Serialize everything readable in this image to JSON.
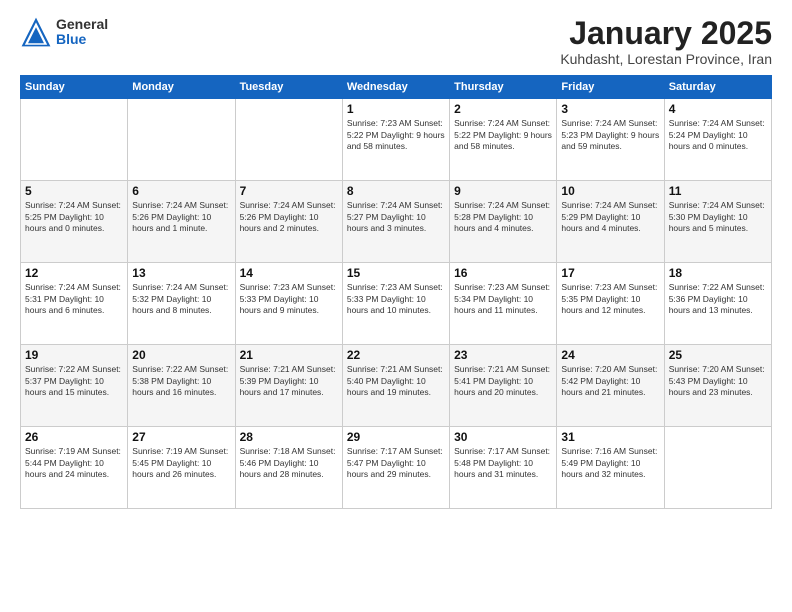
{
  "header": {
    "logo": {
      "general": "General",
      "blue": "Blue"
    },
    "title": "January 2025",
    "subtitle": "Kuhdasht, Lorestan Province, Iran"
  },
  "weekdays": [
    "Sunday",
    "Monday",
    "Tuesday",
    "Wednesday",
    "Thursday",
    "Friday",
    "Saturday"
  ],
  "weeks": [
    [
      {
        "day": "",
        "info": ""
      },
      {
        "day": "",
        "info": ""
      },
      {
        "day": "",
        "info": ""
      },
      {
        "day": "1",
        "info": "Sunrise: 7:23 AM\nSunset: 5:22 PM\nDaylight: 9 hours\nand 58 minutes."
      },
      {
        "day": "2",
        "info": "Sunrise: 7:24 AM\nSunset: 5:22 PM\nDaylight: 9 hours\nand 58 minutes."
      },
      {
        "day": "3",
        "info": "Sunrise: 7:24 AM\nSunset: 5:23 PM\nDaylight: 9 hours\nand 59 minutes."
      },
      {
        "day": "4",
        "info": "Sunrise: 7:24 AM\nSunset: 5:24 PM\nDaylight: 10 hours\nand 0 minutes."
      }
    ],
    [
      {
        "day": "5",
        "info": "Sunrise: 7:24 AM\nSunset: 5:25 PM\nDaylight: 10 hours\nand 0 minutes."
      },
      {
        "day": "6",
        "info": "Sunrise: 7:24 AM\nSunset: 5:26 PM\nDaylight: 10 hours\nand 1 minute."
      },
      {
        "day": "7",
        "info": "Sunrise: 7:24 AM\nSunset: 5:26 PM\nDaylight: 10 hours\nand 2 minutes."
      },
      {
        "day": "8",
        "info": "Sunrise: 7:24 AM\nSunset: 5:27 PM\nDaylight: 10 hours\nand 3 minutes."
      },
      {
        "day": "9",
        "info": "Sunrise: 7:24 AM\nSunset: 5:28 PM\nDaylight: 10 hours\nand 4 minutes."
      },
      {
        "day": "10",
        "info": "Sunrise: 7:24 AM\nSunset: 5:29 PM\nDaylight: 10 hours\nand 4 minutes."
      },
      {
        "day": "11",
        "info": "Sunrise: 7:24 AM\nSunset: 5:30 PM\nDaylight: 10 hours\nand 5 minutes."
      }
    ],
    [
      {
        "day": "12",
        "info": "Sunrise: 7:24 AM\nSunset: 5:31 PM\nDaylight: 10 hours\nand 6 minutes."
      },
      {
        "day": "13",
        "info": "Sunrise: 7:24 AM\nSunset: 5:32 PM\nDaylight: 10 hours\nand 8 minutes."
      },
      {
        "day": "14",
        "info": "Sunrise: 7:23 AM\nSunset: 5:33 PM\nDaylight: 10 hours\nand 9 minutes."
      },
      {
        "day": "15",
        "info": "Sunrise: 7:23 AM\nSunset: 5:33 PM\nDaylight: 10 hours\nand 10 minutes."
      },
      {
        "day": "16",
        "info": "Sunrise: 7:23 AM\nSunset: 5:34 PM\nDaylight: 10 hours\nand 11 minutes."
      },
      {
        "day": "17",
        "info": "Sunrise: 7:23 AM\nSunset: 5:35 PM\nDaylight: 10 hours\nand 12 minutes."
      },
      {
        "day": "18",
        "info": "Sunrise: 7:22 AM\nSunset: 5:36 PM\nDaylight: 10 hours\nand 13 minutes."
      }
    ],
    [
      {
        "day": "19",
        "info": "Sunrise: 7:22 AM\nSunset: 5:37 PM\nDaylight: 10 hours\nand 15 minutes."
      },
      {
        "day": "20",
        "info": "Sunrise: 7:22 AM\nSunset: 5:38 PM\nDaylight: 10 hours\nand 16 minutes."
      },
      {
        "day": "21",
        "info": "Sunrise: 7:21 AM\nSunset: 5:39 PM\nDaylight: 10 hours\nand 17 minutes."
      },
      {
        "day": "22",
        "info": "Sunrise: 7:21 AM\nSunset: 5:40 PM\nDaylight: 10 hours\nand 19 minutes."
      },
      {
        "day": "23",
        "info": "Sunrise: 7:21 AM\nSunset: 5:41 PM\nDaylight: 10 hours\nand 20 minutes."
      },
      {
        "day": "24",
        "info": "Sunrise: 7:20 AM\nSunset: 5:42 PM\nDaylight: 10 hours\nand 21 minutes."
      },
      {
        "day": "25",
        "info": "Sunrise: 7:20 AM\nSunset: 5:43 PM\nDaylight: 10 hours\nand 23 minutes."
      }
    ],
    [
      {
        "day": "26",
        "info": "Sunrise: 7:19 AM\nSunset: 5:44 PM\nDaylight: 10 hours\nand 24 minutes."
      },
      {
        "day": "27",
        "info": "Sunrise: 7:19 AM\nSunset: 5:45 PM\nDaylight: 10 hours\nand 26 minutes."
      },
      {
        "day": "28",
        "info": "Sunrise: 7:18 AM\nSunset: 5:46 PM\nDaylight: 10 hours\nand 28 minutes."
      },
      {
        "day": "29",
        "info": "Sunrise: 7:17 AM\nSunset: 5:47 PM\nDaylight: 10 hours\nand 29 minutes."
      },
      {
        "day": "30",
        "info": "Sunrise: 7:17 AM\nSunset: 5:48 PM\nDaylight: 10 hours\nand 31 minutes."
      },
      {
        "day": "31",
        "info": "Sunrise: 7:16 AM\nSunset: 5:49 PM\nDaylight: 10 hours\nand 32 minutes."
      },
      {
        "day": "",
        "info": ""
      }
    ]
  ]
}
